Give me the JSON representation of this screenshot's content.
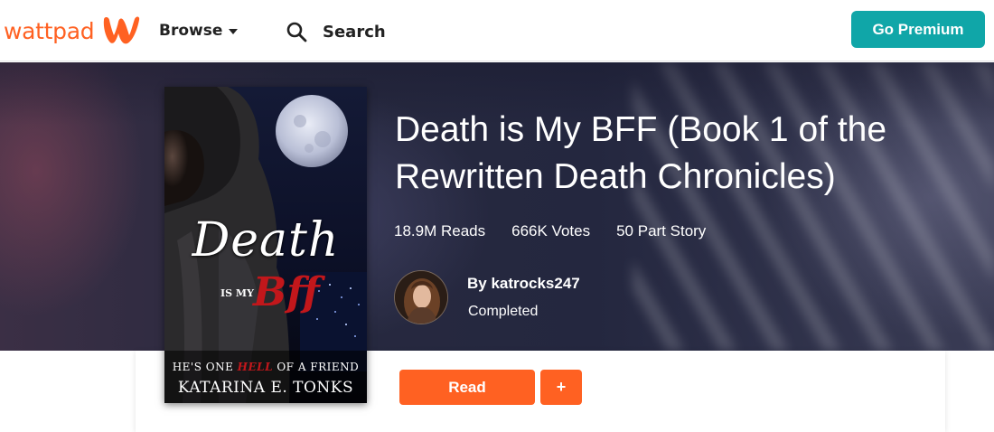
{
  "nav": {
    "logo_text": "wattpad",
    "logo_icon": "wattpad-w-icon",
    "browse_label": "Browse",
    "search_label": "Search",
    "premium_label": "Go Premium"
  },
  "colors": {
    "brand_orange": "#ff6122",
    "premium_teal": "#10a6a8"
  },
  "story": {
    "title": "Death is My BFF (Book 1 of the Rewritten Death Chronicles)",
    "stats": {
      "reads": "18.9M Reads",
      "votes": "666K Votes",
      "parts": "50 Part Story"
    },
    "author": "By katrocks247",
    "status": "Completed"
  },
  "cover": {
    "title_word_1": "Death",
    "title_word_2": "IS MY",
    "title_word_3": "Bff",
    "tagline_before": "HE'S ONE ",
    "tagline_highlight": "HELL",
    "tagline_after": " OF A FRIEND",
    "author_name": "KATARINA E. TONKS"
  },
  "actions": {
    "read_label": "Read",
    "add_label": "+"
  }
}
